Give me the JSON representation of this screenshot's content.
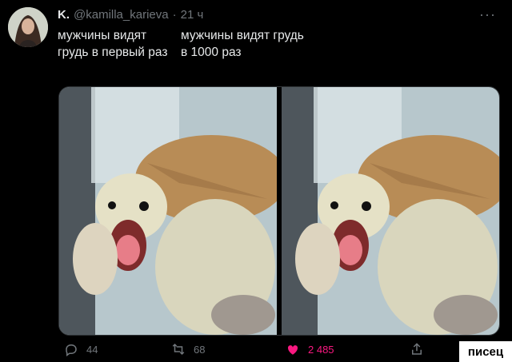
{
  "tweet": {
    "display_name": "K.",
    "handle": "@kamilla_karieva",
    "separator": "·",
    "time": "21 ч",
    "more_label": "···",
    "text_left": "мужчины видят грудь в первый раз",
    "text_right": "мужчины видят грудь в 1000 раз"
  },
  "actions": {
    "reply_count": "44",
    "retweet_count": "68",
    "like_count": "2 485"
  },
  "watermark": "писец",
  "colors": {
    "like": "#f91880",
    "muted": "#71767b",
    "text": "#e7e9ea"
  },
  "icons": [
    "reply-icon",
    "retweet-icon",
    "heart-icon",
    "share-icon"
  ]
}
